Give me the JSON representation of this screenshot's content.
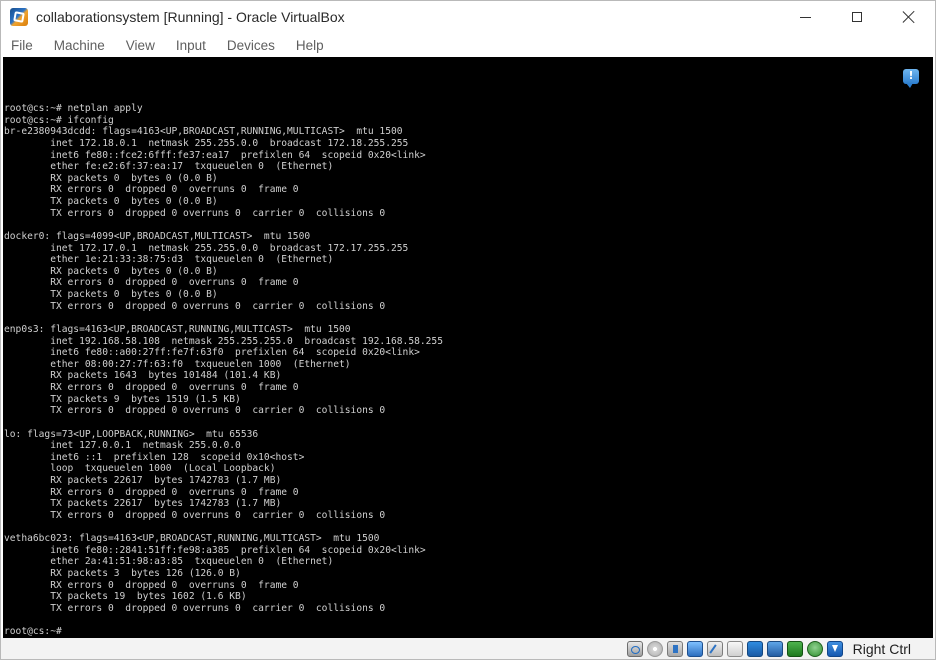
{
  "window": {
    "title": "collaborationsystem [Running] - Oracle VirtualBox",
    "app_icon": "virtualbox-icon",
    "controls": [
      "minimize-icon",
      "maximize-icon",
      "close-icon"
    ]
  },
  "menu": {
    "items": [
      {
        "label": "File"
      },
      {
        "label": "Machine"
      },
      {
        "label": "View"
      },
      {
        "label": "Input"
      },
      {
        "label": "Devices"
      },
      {
        "label": "Help"
      }
    ]
  },
  "screen": {
    "notification_icon": "info-notification-icon",
    "terminal_text": "root@cs:~# netplan apply\nroot@cs:~# ifconfig\nbr-e2380943dcdd: flags=4163<UP,BROADCAST,RUNNING,MULTICAST>  mtu 1500\n        inet 172.18.0.1  netmask 255.255.0.0  broadcast 172.18.255.255\n        inet6 fe80::fce2:6fff:fe37:ea17  prefixlen 64  scopeid 0x20<link>\n        ether fe:e2:6f:37:ea:17  txqueuelen 0  (Ethernet)\n        RX packets 0  bytes 0 (0.0 B)\n        RX errors 0  dropped 0  overruns 0  frame 0\n        TX packets 0  bytes 0 (0.0 B)\n        TX errors 0  dropped 0 overruns 0  carrier 0  collisions 0\n\ndocker0: flags=4099<UP,BROADCAST,MULTICAST>  mtu 1500\n        inet 172.17.0.1  netmask 255.255.0.0  broadcast 172.17.255.255\n        ether 1e:21:33:38:75:d3  txqueuelen 0  (Ethernet)\n        RX packets 0  bytes 0 (0.0 B)\n        RX errors 0  dropped 0  overruns 0  frame 0\n        TX packets 0  bytes 0 (0.0 B)\n        TX errors 0  dropped 0 overruns 0  carrier 0  collisions 0\n\nenp0s3: flags=4163<UP,BROADCAST,RUNNING,MULTICAST>  mtu 1500\n        inet 192.168.58.108  netmask 255.255.255.0  broadcast 192.168.58.255\n        inet6 fe80::a00:27ff:fe7f:63f0  prefixlen 64  scopeid 0x20<link>\n        ether 08:00:27:7f:63:f0  txqueuelen 1000  (Ethernet)\n        RX packets 1643  bytes 101484 (101.4 KB)\n        RX errors 0  dropped 0  overruns 0  frame 0\n        TX packets 9  bytes 1519 (1.5 KB)\n        TX errors 0  dropped 0 overruns 0  carrier 0  collisions 0\n\nlo: flags=73<UP,LOOPBACK,RUNNING>  mtu 65536\n        inet 127.0.0.1  netmask 255.0.0.0\n        inet6 ::1  prefixlen 128  scopeid 0x10<host>\n        loop  txqueuelen 1000  (Local Loopback)\n        RX packets 22617  bytes 1742783 (1.7 MB)\n        RX errors 0  dropped 0  overruns 0  frame 0\n        TX packets 22617  bytes 1742783 (1.7 MB)\n        TX errors 0  dropped 0 overruns 0  carrier 0  collisions 0\n\nvetha6bc023: flags=4163<UP,BROADCAST,RUNNING,MULTICAST>  mtu 1500\n        inet6 fe80::2841:51ff:fe98:a385  prefixlen 64  scopeid 0x20<link>\n        ether 2a:41:51:98:a3:85  txqueuelen 0  (Ethernet)\n        RX packets 3  bytes 126 (126.0 B)\n        RX errors 0  dropped 0  overruns 0  frame 0\n        TX packets 19  bytes 1602 (1.6 KB)\n        TX errors 0  dropped 0 overruns 0  carrier 0  collisions 0\n\nroot@cs:~#"
  },
  "statusbar": {
    "icons": [
      "hard-disk-icon",
      "optical-drive-icon",
      "audio-icon",
      "network-icon",
      "usb-icon",
      "shared-folders-icon",
      "display-icon",
      "recording-icon",
      "cpu-icon",
      "mouse-integration-icon",
      "keyboard-capture-icon"
    ],
    "host_key": "Right Ctrl"
  }
}
